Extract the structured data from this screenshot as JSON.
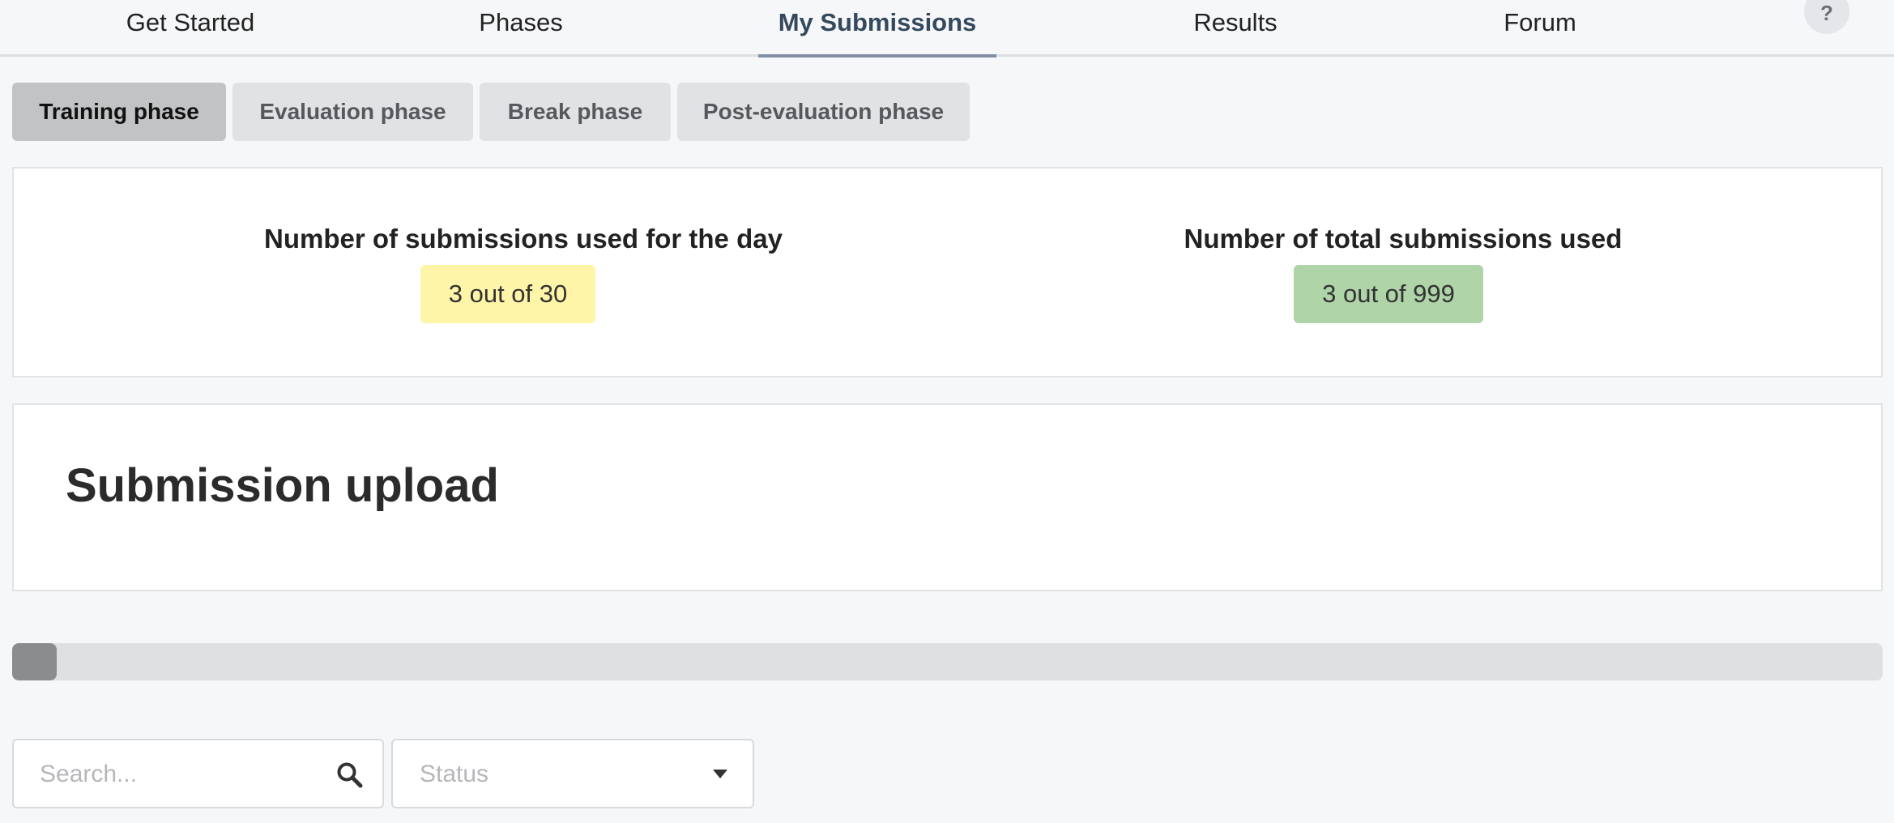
{
  "nav": {
    "items": [
      {
        "label": "Get Started"
      },
      {
        "label": "Phases"
      },
      {
        "label": "My Submissions"
      },
      {
        "label": "Results"
      },
      {
        "label": "Forum"
      }
    ],
    "active": "My Submissions",
    "help_label": "?"
  },
  "phases": {
    "tabs": [
      {
        "label": "Training phase"
      },
      {
        "label": "Evaluation phase"
      },
      {
        "label": "Break phase"
      },
      {
        "label": "Post-evaluation phase"
      }
    ],
    "active": "Training phase"
  },
  "stats": {
    "daily": {
      "label": "Number of submissions used for the day",
      "value": "3 out of 30",
      "color": "#fff5a8"
    },
    "total": {
      "label": "Number of total submissions used",
      "value": "3 out of 999",
      "color": "#aed4a8"
    }
  },
  "upload": {
    "title": "Submission upload"
  },
  "progress": {
    "value": 0.024
  },
  "filters": {
    "search_placeholder": "Search...",
    "status_placeholder": "Status"
  },
  "icons": {
    "search": "search-icon",
    "status_caret": "caret-down-icon",
    "help": "question-icon"
  }
}
